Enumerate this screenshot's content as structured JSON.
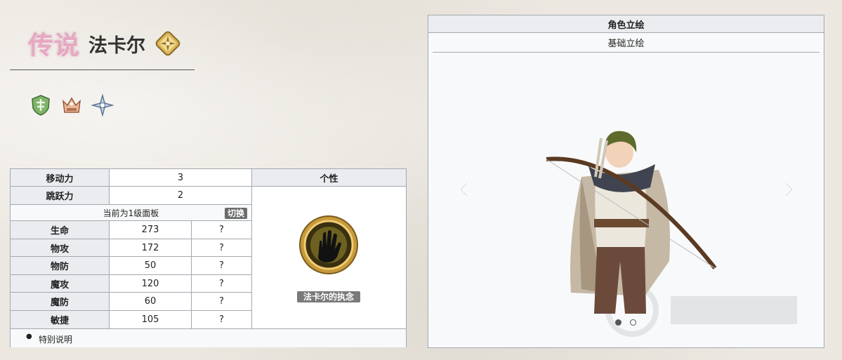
{
  "header": {
    "rarity": "传说",
    "name": "法卡尔",
    "class_icon": "compass-star-badge-icon",
    "trait_icons": [
      "shield-emblem-icon",
      "crown-emblem-icon",
      "star-emblem-icon"
    ]
  },
  "stats": {
    "move_label": "移动力",
    "move_value": "3",
    "jump_label": "跳跃力",
    "jump_value": "2",
    "level_note": "当前为1级面板",
    "toggle_label": "切换",
    "personality_label": "个性",
    "rows": [
      {
        "label": "生命",
        "value": "273",
        "extra": "?"
      },
      {
        "label": "物攻",
        "value": "172",
        "extra": "?"
      },
      {
        "label": "物防",
        "value": "50",
        "extra": "?"
      },
      {
        "label": "魔攻",
        "value": "120",
        "extra": "?"
      },
      {
        "label": "魔防",
        "value": "60",
        "extra": "?"
      },
      {
        "label": "敏捷",
        "value": "105",
        "extra": "?"
      }
    ],
    "skill_name": "法卡尔的执念",
    "skill_icon": "grasping-hand-icon",
    "special_note": "特别说明"
  },
  "portrait": {
    "title": "角色立绘",
    "tab": "基础立绘",
    "slides": 2,
    "active_slide": 1
  },
  "colors": {
    "header_bg": "#eaecf0",
    "border": "#a2a9b1",
    "rarity_pink": "#e7a7c2",
    "toggle_bg": "#6b6b6b"
  }
}
